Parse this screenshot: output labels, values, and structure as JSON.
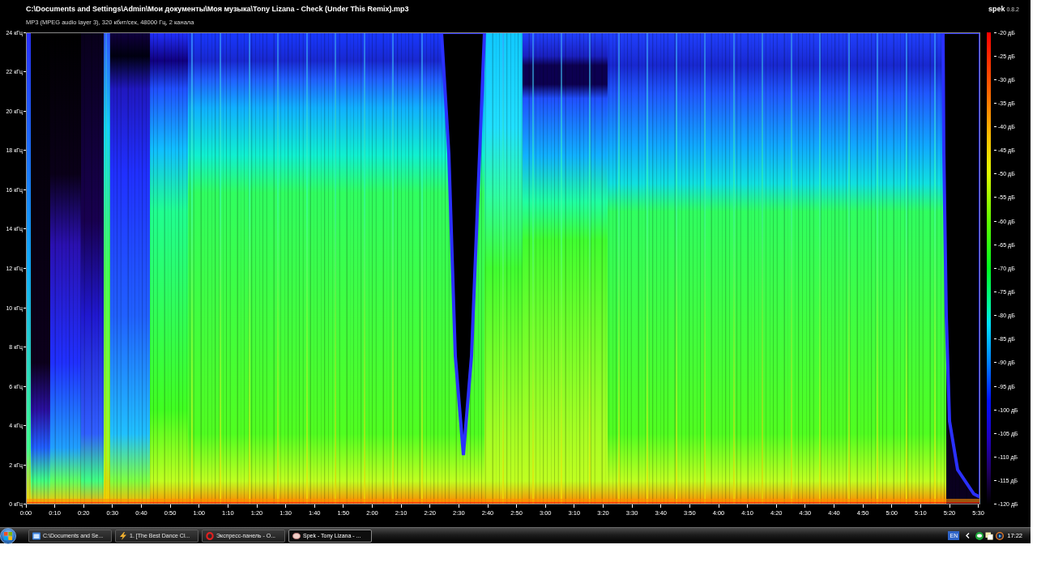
{
  "window": {
    "title": "C:\\Documents and Settings\\Admin\\Мои документы\\Моя музыка\\Tony Lizana - Check (Under This Remix).mp3",
    "subtitle": "MP3 (MPEG audio layer 3), 320 кбит/сек, 48000 Гц, 2 канала"
  },
  "app_badge": {
    "name": "spek",
    "version": "0.8.2"
  },
  "spectrogram": {
    "frequency_labels": [
      "24 кГц",
      "22 кГц",
      "20 кГц",
      "18 кГц",
      "16 кГц",
      "14 кГц",
      "12 кГц",
      "10 кГц",
      "8 кГц",
      "6 кГц",
      "4 кГц",
      "2 кГц",
      "0 кГц"
    ],
    "time_labels": [
      "0:00",
      "0:10",
      "0:20",
      "0:30",
      "0:40",
      "0:50",
      "1:00",
      "1:10",
      "1:20",
      "1:30",
      "1:40",
      "1:50",
      "2:00",
      "2:10",
      "2:20",
      "2:30",
      "2:40",
      "2:50",
      "3:00",
      "3:10",
      "3:20",
      "3:30",
      "3:40",
      "3:50",
      "4:00",
      "4:10",
      "4:20",
      "4:30",
      "4:40",
      "4:50",
      "5:00",
      "5:10",
      "5:20",
      "5:30"
    ],
    "scale_labels": [
      "-20 дБ",
      "-25 дБ",
      "-30 дБ",
      "-35 дБ",
      "-40 дБ",
      "-45 дБ",
      "-50 дБ",
      "-55 дБ",
      "-60 дБ",
      "-65 дБ",
      "-70 дБ",
      "-75 дБ",
      "-80 дБ",
      "-85 дБ",
      "-90 дБ",
      "-95 дБ",
      "-100 дБ",
      "-105 дБ",
      "-110 дБ",
      "-115 дБ",
      "-120 дБ"
    ]
  },
  "taskbar": {
    "buttons": [
      {
        "kind": "explorer",
        "label": "C:\\Documents and Se...",
        "selected": false
      },
      {
        "kind": "player",
        "label": "1. [The Best Dance Cl...",
        "selected": false
      },
      {
        "kind": "browser",
        "label": "Экспресс-панель - О...",
        "selected": false
      },
      {
        "kind": "spek",
        "label": "Spek - Tony Lizana - ...",
        "selected": true
      }
    ],
    "tray": {
      "language": "EN",
      "clock": "17:22"
    }
  }
}
